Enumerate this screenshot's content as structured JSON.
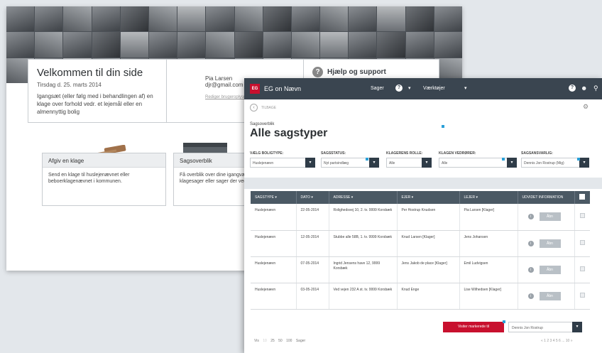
{
  "back_screen": {
    "welcome_title": "Velkommen til din side",
    "welcome_date": "Tirsdag d. 25. marts 2014",
    "welcome_intro": "Igangsæt (eller følg med i behandlingen af) en klage over forhold vedr. et lejemål eller en almennyttig bolig",
    "user_name": "Pia Larsen",
    "user_email": "djr@gmail.com",
    "user_edit": "Rediger brugeroplysninger",
    "help_label": "Hjælp og support",
    "card1_title": "Afgiv en klage",
    "card1_text": "Send en klage til huslejenævnet eller beboerklagenævnet i kommunen.",
    "card2_title": "Sagsoverblik",
    "card2_text": "Få overblik over dine igangværende og afsluttede klagesager eller sager der vedrører dig."
  },
  "front_screen": {
    "logo": "EG",
    "app_name": "EG on Nævn",
    "nav_sager": "Sager",
    "nav_tools": "Værktøjer",
    "back_label": "TILBAGE",
    "breadcrumb": "Sagsoverblik",
    "page_title": "Alle sagstyper",
    "filters": [
      {
        "label": "VÆLG BOLIGTYPE:",
        "value": "Huslejenævn"
      },
      {
        "label": "SAGSSTATUS:",
        "value": "Nyt partsindlæg"
      },
      {
        "label": "KLAGERENS ROLLE:",
        "value": "Alle"
      },
      {
        "label": "KLAGEN VEDRØRER:",
        "value": "Alle"
      },
      {
        "label": "SAGSANSVARLIG:",
        "value": "Dennis Jon Rostrup (Mig)"
      }
    ],
    "columns": [
      "SAGSTYPE",
      "DATO",
      "ADRESSE",
      "EJER",
      "LEJER",
      "UDVIDET INFORMATION"
    ],
    "rows": [
      {
        "type": "Huslejenævn",
        "date": "22-05-2014",
        "address": "Rolighedsvej 10, 2. tv. 9999 Korsbæk",
        "owner": "Per Hostrup Knudsen",
        "tenant": "Pia Larsen [Klager]",
        "action": "Åbn"
      },
      {
        "type": "Huslejenævn",
        "date": "12-05-2014",
        "address": "Stubbe alle 58B, 1. tv. 9999 Korsbæk",
        "owner": "Knud Larsen [Klager]",
        "tenant": "Jens Johansen",
        "action": "Åbn"
      },
      {
        "type": "Huslejenævn",
        "date": "07-05-2014",
        "address": "Ingrid Jensens have 12, 9999 Korsbæk",
        "owner": "Jens Jakob de place [Klager]",
        "tenant": "Emil Ludvigsen",
        "action": "Åbn"
      },
      {
        "type": "Huslejenævn",
        "date": "03-05-2014",
        "address": "Ved vejen 232 A st. tv. 9999 Korsbæk",
        "owner": "Knud Enge",
        "tenant": "Lise Wilhedsen [Klager]",
        "action": "Åbn"
      }
    ],
    "bulk_button": "Visiter markerede til",
    "assign_value": "Dennis Jon Rostrup",
    "pager_show": "Vis",
    "pager_sizes": [
      "10",
      "25",
      "50",
      "100"
    ],
    "pager_suffix": "Sager",
    "pager_pages": "« 1 2 3 4 5 6 ... 10 »"
  }
}
